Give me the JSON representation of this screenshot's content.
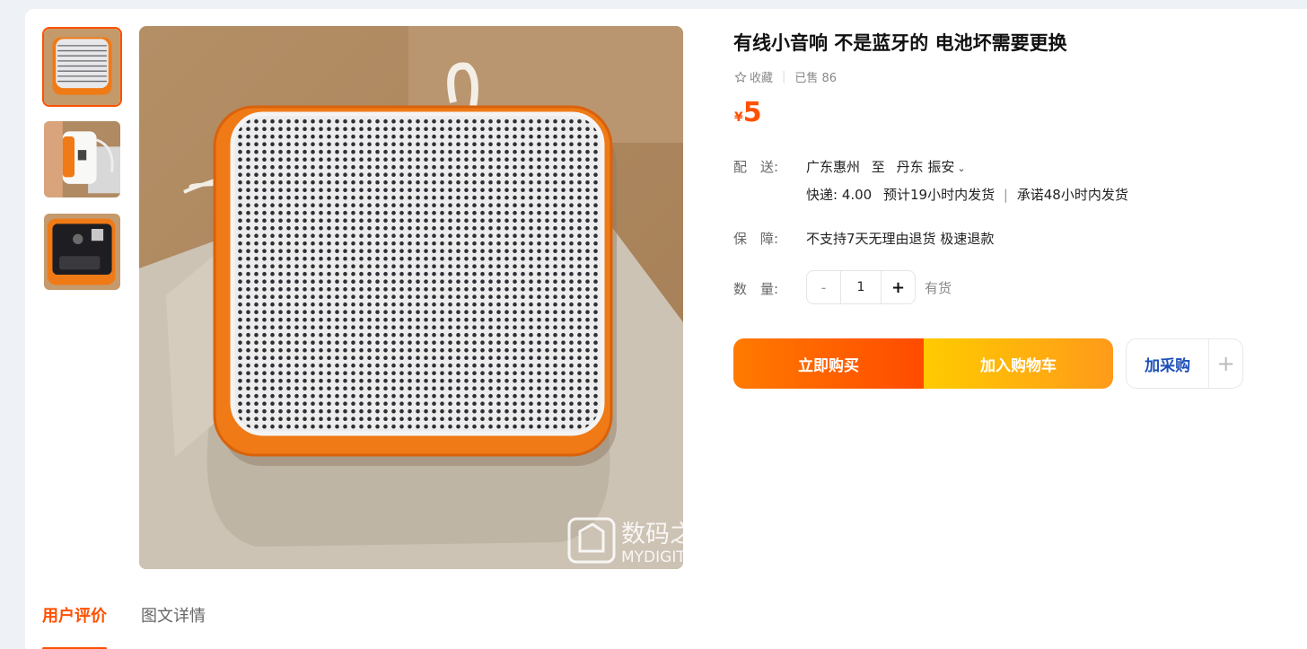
{
  "product": {
    "title": "有线小音响 不是蓝牙的 电池坏需要更换",
    "favorite_label": "收藏",
    "sold_label": "已售 86",
    "currency": "¥",
    "price": "5"
  },
  "delivery": {
    "label": "配　送:",
    "from": "广东惠州",
    "to_word": "至",
    "destination": "丹东 振安",
    "express": "快递: 4.00",
    "eta": "预计19小时内发货",
    "promise": "承诺48小时内发货"
  },
  "guarantee": {
    "label": "保　障:",
    "text": "不支持7天无理由退货 极速退款"
  },
  "quantity": {
    "label": "数　量:",
    "minus": "-",
    "value": "1",
    "plus": "+",
    "stock": "有货"
  },
  "actions": {
    "buy_now": "立即购买",
    "add_cart": "加入购物车",
    "add_purchase": "加采购",
    "add_icon": "plus-icon"
  },
  "tabs": [
    {
      "label": "用户评价",
      "active": true
    },
    {
      "label": "图文详情",
      "active": false
    }
  ],
  "watermark": {
    "cn": "数码之家",
    "en": "MYDIGIT.NET"
  },
  "colors": {
    "accent": "#ff5000",
    "speaker_orange": "#f07a16",
    "link_blue": "#1d4fb8"
  }
}
